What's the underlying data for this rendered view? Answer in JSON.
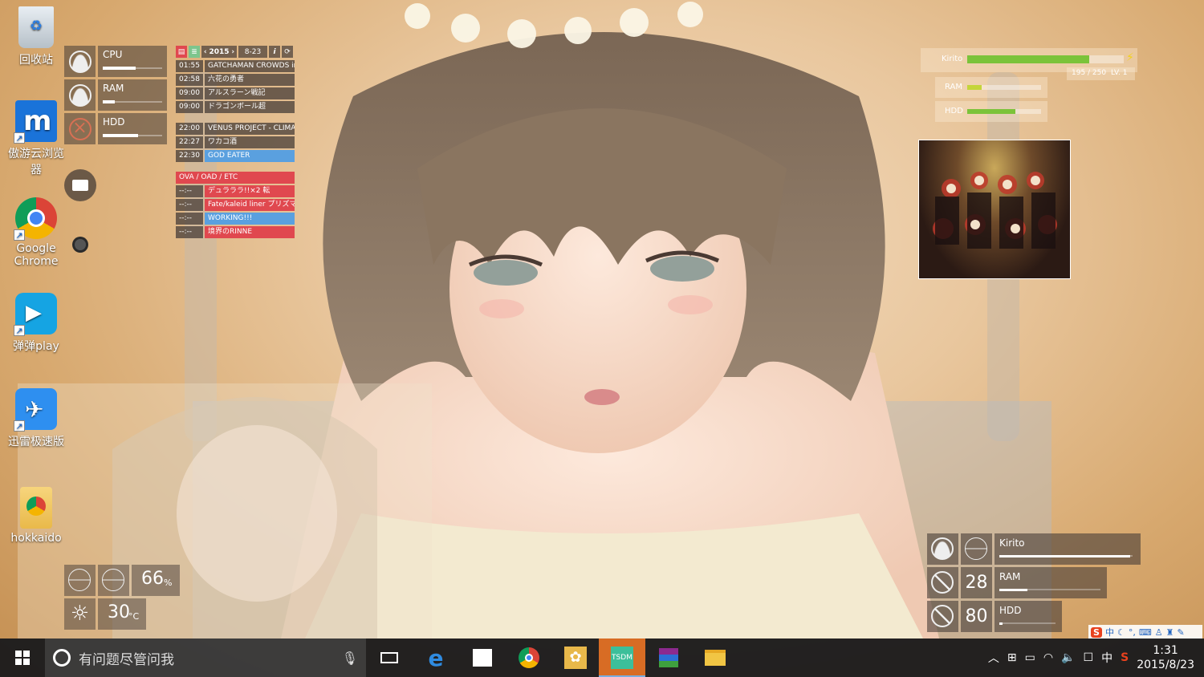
{
  "desktop_icons": [
    {
      "label": "回收站",
      "icon": "recycle-bin-icon"
    },
    {
      "label": "傲游云浏览器",
      "icon": "maxthon-icon"
    },
    {
      "label": "Google Chrome",
      "icon": "chrome-icon"
    },
    {
      "label": "弹弹play",
      "icon": "dandanplay-icon"
    },
    {
      "label": "迅雷极速版",
      "icon": "xunlei-icon"
    },
    {
      "label": "hokkaido",
      "icon": "folder-chrome-icon"
    }
  ],
  "system_widget": {
    "rows": [
      {
        "label": "CPU",
        "level": 0.55
      },
      {
        "label": "RAM",
        "level": 0.2
      },
      {
        "label": "HDD",
        "level": 0.6
      }
    ]
  },
  "schedule": {
    "year": "2015",
    "date": "8-23",
    "info": "i",
    "refresh": "⟳",
    "prev": "‹",
    "next": "›",
    "group1": [
      {
        "time": "01:55",
        "title": "GATCHAMAN CROWDS insight"
      },
      {
        "time": "02:58",
        "title": "六花の勇者"
      },
      {
        "time": "09:00",
        "title": "アルスラーン戦記"
      },
      {
        "time": "09:00",
        "title": "ドラゴンボール超"
      }
    ],
    "group2": [
      {
        "time": "22:00",
        "title": "VENUS PROJECT - CLIMAX -"
      },
      {
        "time": "22:27",
        "title": "ワカコ酒"
      },
      {
        "time": "22:30",
        "title": "GOD EATER"
      }
    ],
    "ova_header": "OVA / OAD / ETC",
    "group3": [
      {
        "time": "--:--",
        "title": "デュラララ!!×2 転"
      },
      {
        "time": "--:--",
        "title": "Fate/kaleid liner プリズマ☆イ"
      },
      {
        "time": "--:--",
        "title": "WORKING!!!"
      },
      {
        "time": "--:--",
        "title": "境界のRINNE"
      }
    ]
  },
  "game_widget": {
    "name": "Kirito",
    "hp": "195 / 250",
    "level": "LV. 1",
    "ram": "RAM",
    "hdd": "HDD",
    "hp_level": 0.78,
    "ram_level": 0.2,
    "hdd_level": 0.65
  },
  "bottom_right_widget": {
    "name": "Kirito",
    "ram_value": "28",
    "hdd_value": "80",
    "ram_label": "RAM",
    "hdd_label": "HDD",
    "name_level": 0.98,
    "ram_level": 0.28,
    "hdd_level": 0.05
  },
  "weather_widget": {
    "humidity": "66",
    "humidity_unit": "%",
    "temperature": "30",
    "temperature_unit": "°C"
  },
  "taskbar": {
    "search_placeholder": "有问题尽管问我",
    "apps": [
      "task-view",
      "edge",
      "store",
      "chrome",
      "settings",
      "tsdm",
      "winrar",
      "file-explorer"
    ],
    "ime_mode": "中",
    "time": "1:31",
    "date": "2015/8/23"
  },
  "ime_toolbar": {
    "mode": "中"
  },
  "colors": {
    "taskbar": "#16181c",
    "hp_green": "#7bc33a",
    "schedule_red": "#e0484f",
    "schedule_blue": "#5aa0df"
  }
}
